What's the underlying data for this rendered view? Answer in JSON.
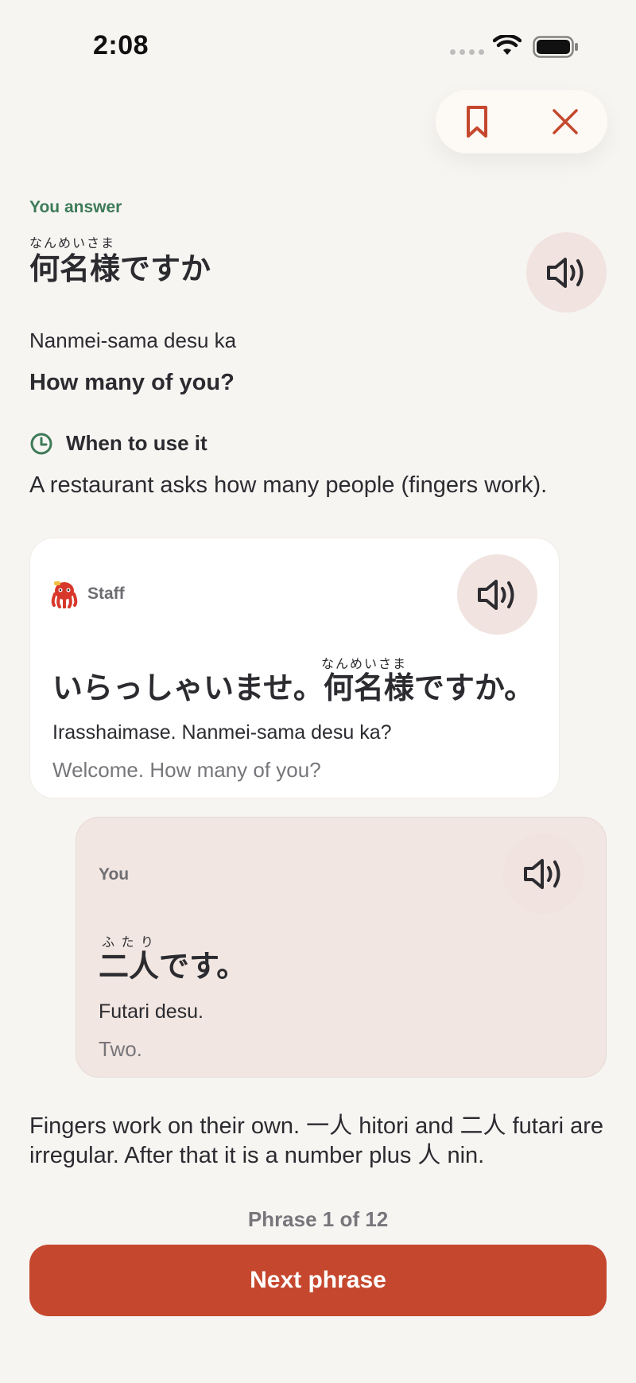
{
  "status_bar": {
    "time": "2:08",
    "icons": [
      "signal-dots-icon",
      "wifi-icon",
      "battery-icon"
    ]
  },
  "header": {
    "actions": [
      "bookmark-icon",
      "close-icon"
    ],
    "accent_color": "#c5482e"
  },
  "phrase": {
    "label": "You answer",
    "furigana": "なんめいさま",
    "japanese": "何名様ですか",
    "romaji": "Nanmei-sama desu ka",
    "english": "How many of you?",
    "audio_icon": "speaker-icon"
  },
  "when_to_use": {
    "icon": "clock-icon",
    "label": "When to use it",
    "description": "A restaurant asks how many people (fingers work)."
  },
  "dialogue": [
    {
      "speaker": "Staff",
      "speaker_icon": "octopus-mascot-icon",
      "furigana": "なんめいさま",
      "japanese_part1": "いらっしゃいませ。",
      "japanese_part2": "何名様ですか。",
      "romaji": "Irasshaimase. Nanmei-sama desu ka?",
      "english": "Welcome. How many of you?"
    },
    {
      "speaker": "You",
      "furigana": "ふ た り",
      "japanese": "二人です。",
      "romaji": "Futari desu.",
      "english": "Two."
    }
  ],
  "note": "Fingers work on their own. 一人 hitori and 二人 futari are irregular. After that it is a number plus 人 nin.",
  "footer": {
    "progress": "Phrase 1 of 12",
    "next_label": "Next phrase"
  },
  "colors": {
    "background": "#f7f5f2",
    "primary": "#c5482e",
    "label_green": "#3d7a58",
    "audio_bg": "#f1e3df"
  }
}
